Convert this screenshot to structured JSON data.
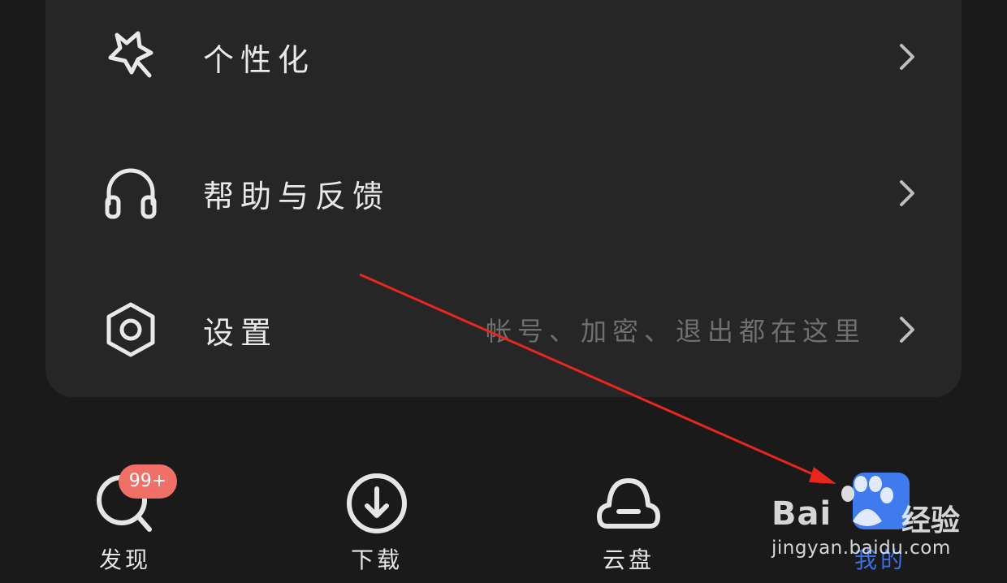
{
  "menu": {
    "items": [
      {
        "label": "个性化",
        "icon": "personalize-star-icon",
        "hint": ""
      },
      {
        "label": "帮助与反馈",
        "icon": "headphones-icon",
        "hint": ""
      },
      {
        "label": "设置",
        "icon": "settings-hexagon-icon",
        "hint": "帐号、加密、退出都在这里"
      }
    ]
  },
  "tabbar": {
    "tabs": [
      {
        "label": "发现",
        "icon": "discover-search-icon",
        "badge": "99+"
      },
      {
        "label": "下载",
        "icon": "download-icon"
      },
      {
        "label": "云盘",
        "icon": "cloud-drive-icon"
      },
      {
        "label": "我的",
        "icon": "profile-icon",
        "active": true
      }
    ]
  },
  "watermark": {
    "logo": "Bai",
    "suffix": "经验",
    "url": "jingyan.baidu.com"
  },
  "colors": {
    "background": "#1a1a1a",
    "card": "#262626",
    "badge": "#f07068",
    "accent": "#3f7bef",
    "annotation_arrow": "#e8261e"
  }
}
